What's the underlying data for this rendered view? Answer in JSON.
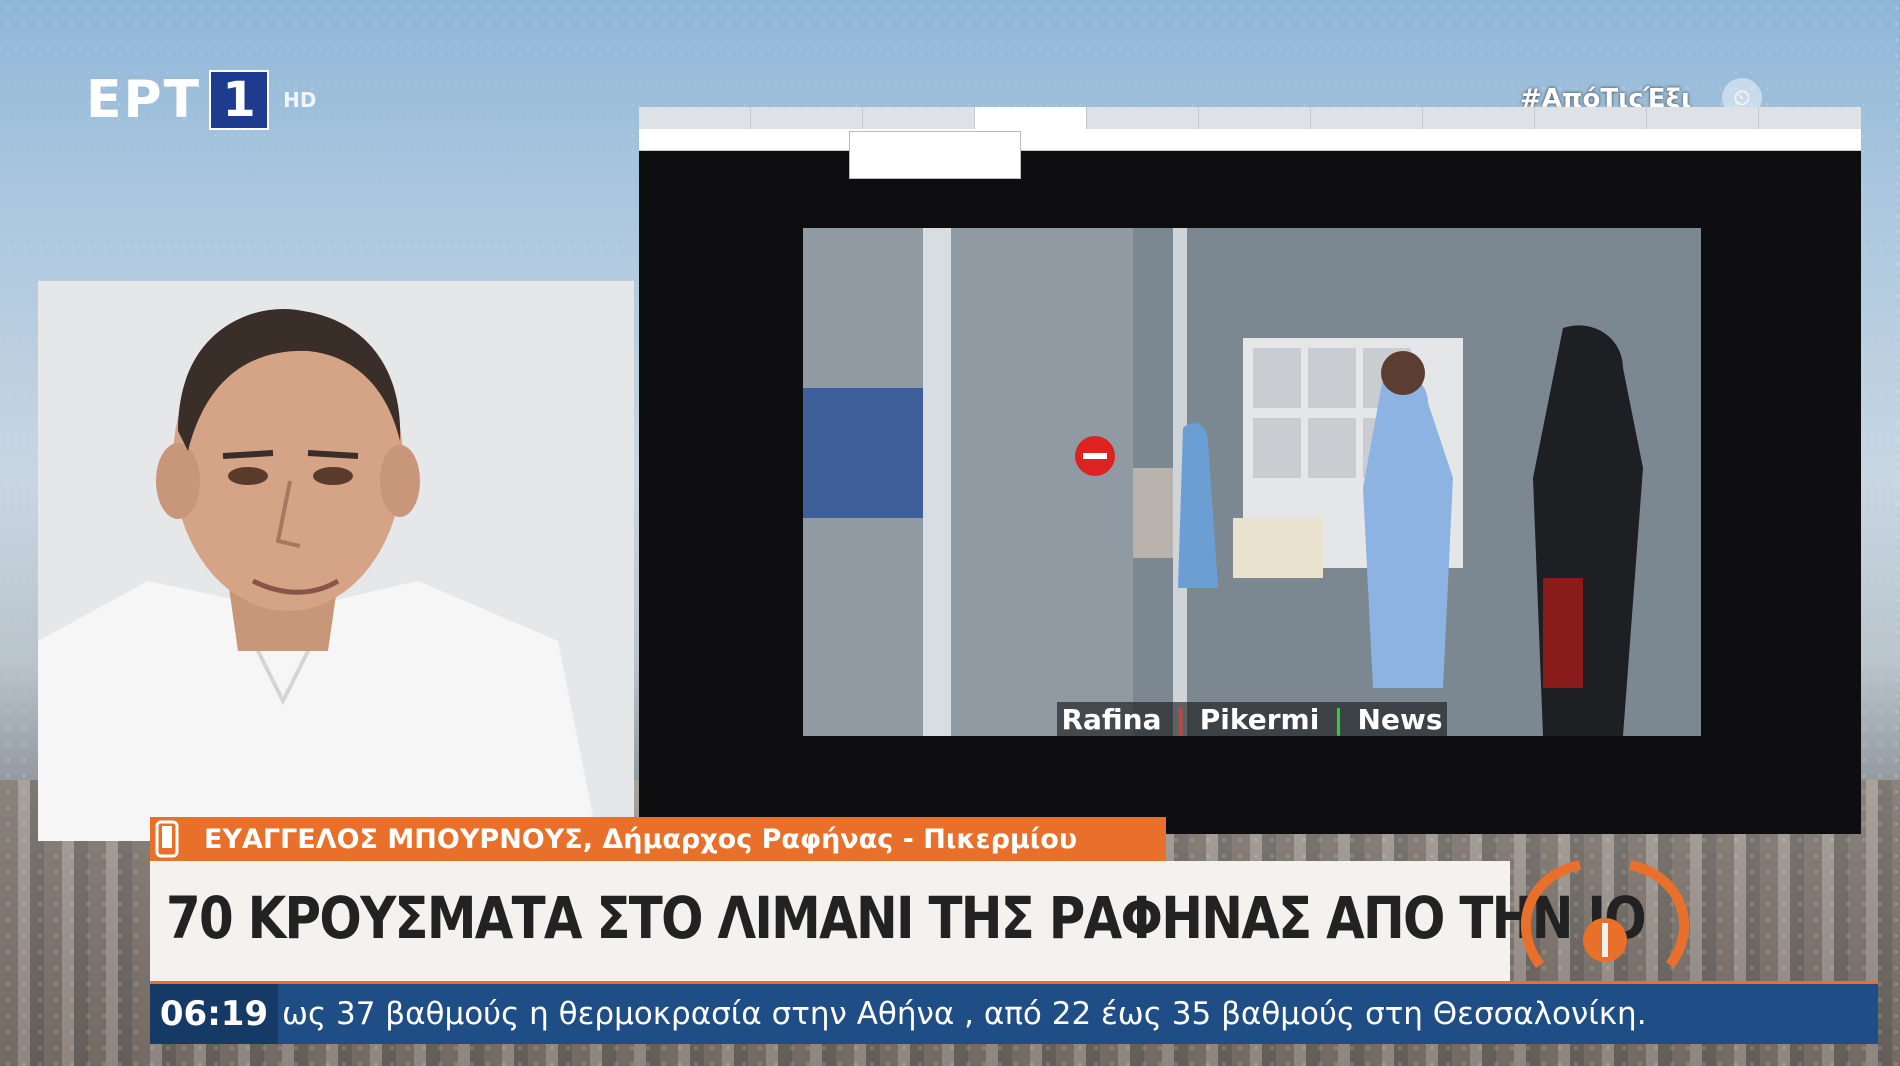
{
  "channel": {
    "logo_text": "ΕΡΤ",
    "logo_number": "1",
    "quality": "HD"
  },
  "hashtag": "#ΑπόΤιςΈξι",
  "browser": {
    "tabs": [
      "",
      "",
      "",
      "",
      "",
      "",
      "",
      "",
      "",
      ""
    ],
    "address": "",
    "tooltip": ""
  },
  "video": {
    "caption_parts": [
      "Rafina",
      "Pikermi",
      "News"
    ]
  },
  "lower_third": {
    "name": "ΕΥΑΓΓΕΛΟΣ ΜΠΟΥΡΝΟΥΣ, Δήμαρχος Ραφήνας - Πικερμίου",
    "headline": "70 ΚΡΟΥΣΜΑΤΑ ΣΤΟ ΛΙΜΑΝΙ ΤΗΣ ΡΑΦΗΝΑΣ ΑΠΟ ΤΗΝ ΙΟ",
    "time": "06:19",
    "ticker": "ως 37 βαθμούς η θερμοκρασία στην Αθήνα , από 22 έως 35 βαθμούς στη Θεσσαλονίκη."
  },
  "colors": {
    "orange": "#e8702a",
    "ticker_blue": "#1f4e86",
    "logo_blue": "#1d3c8f"
  }
}
